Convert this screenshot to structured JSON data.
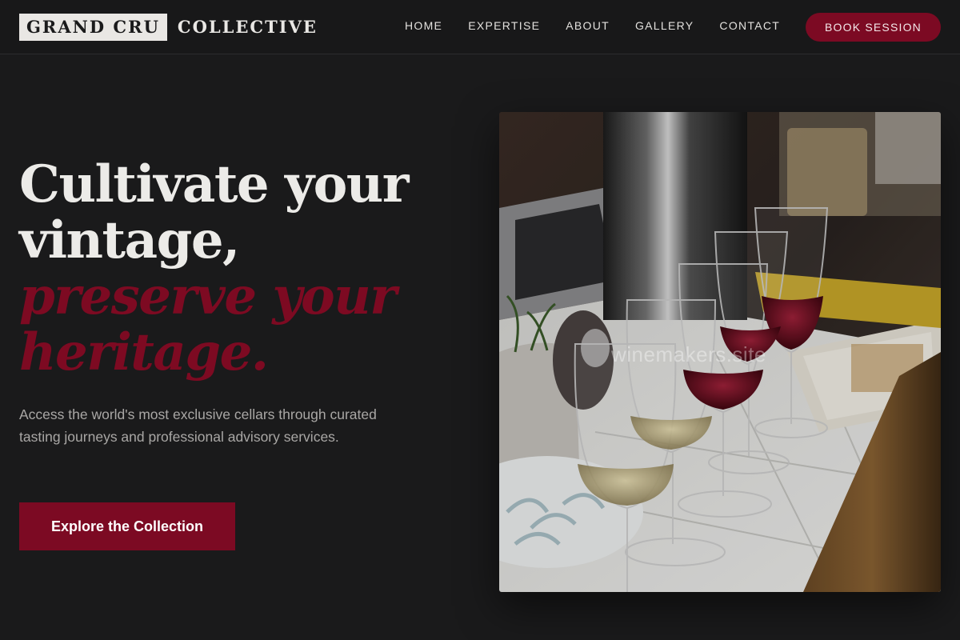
{
  "brand": {
    "name_boxed": "GRAND CRU",
    "name_rest": "COLLECTIVE"
  },
  "nav": {
    "items": [
      {
        "label": "HOME"
      },
      {
        "label": "EXPERTISE"
      },
      {
        "label": "ABOUT"
      },
      {
        "label": "GALLERY"
      },
      {
        "label": "CONTACT"
      }
    ],
    "cta_label": "BOOK SESSION"
  },
  "hero": {
    "title_line1": "Cultivate your",
    "title_line2": "vintage,",
    "title_accent_line1": "preserve your",
    "title_accent_line2": "heritage.",
    "description": "Access the world's most exclusive cellars through curated tasting journeys and professional advisory services.",
    "cta_label": "Explore the Collection"
  },
  "photo": {
    "watermark": "winemakers.site"
  },
  "colors": {
    "background": "#1a1a1b",
    "accent": "#7c0a23",
    "text": "#e8e6e3",
    "muted_text": "#a9a7a5"
  }
}
